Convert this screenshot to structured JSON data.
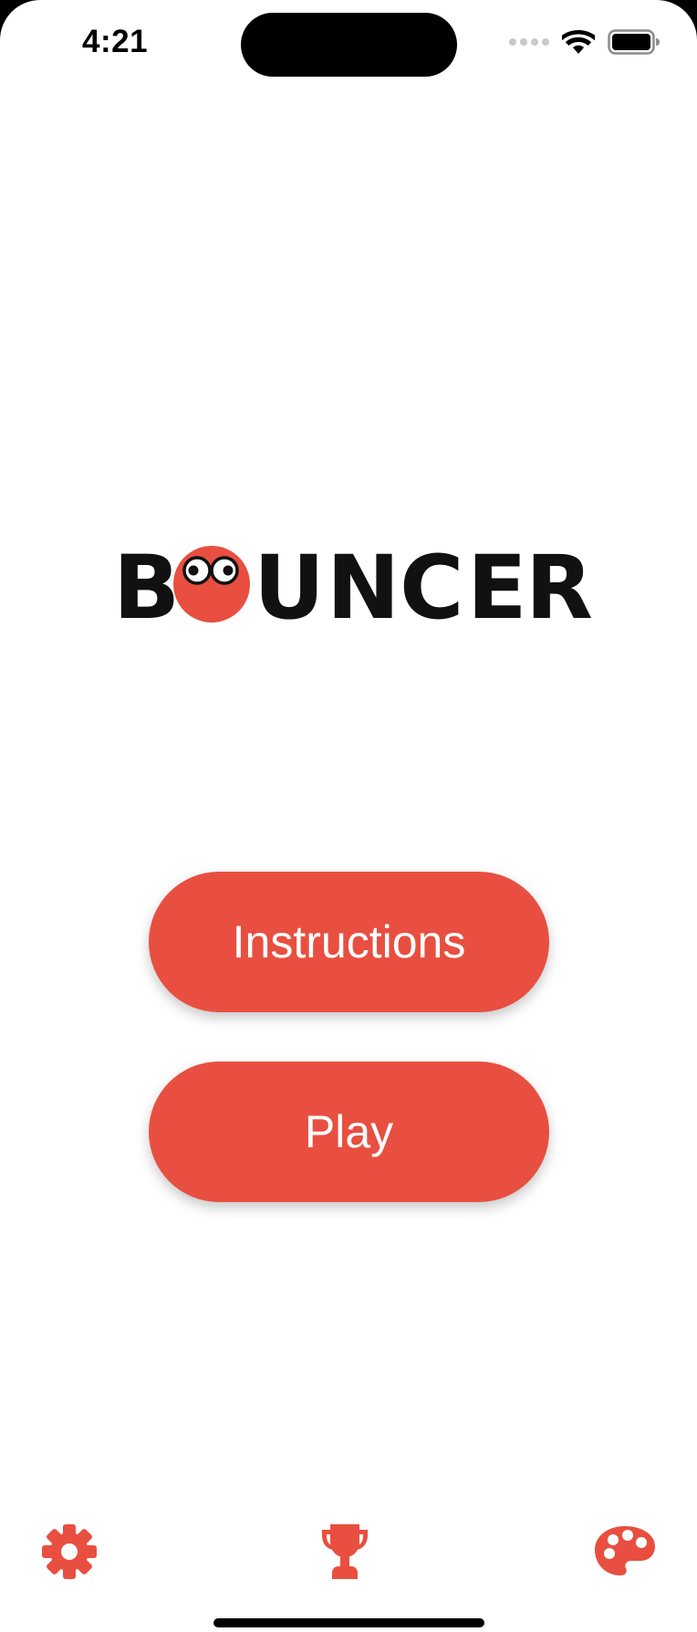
{
  "status_bar": {
    "time": "4:21",
    "icons": [
      "signal-dots",
      "wifi-icon",
      "battery-icon"
    ]
  },
  "logo": {
    "text": "BOUNCER",
    "letters": [
      "B",
      "U",
      "N",
      "C",
      "E",
      "R"
    ],
    "mascot": "red-ball-with-eyes",
    "colors": {
      "text": "#111111",
      "ball": "#e84f40"
    }
  },
  "menu": {
    "instructions_label": "Instructions",
    "play_label": "Play"
  },
  "bottom_bar": {
    "icons": [
      "gear-icon",
      "trophy-icon",
      "palette-icon"
    ]
  },
  "colors": {
    "accent": "#e84f40",
    "background": "#ffffff",
    "button_text": "#ffffff"
  }
}
